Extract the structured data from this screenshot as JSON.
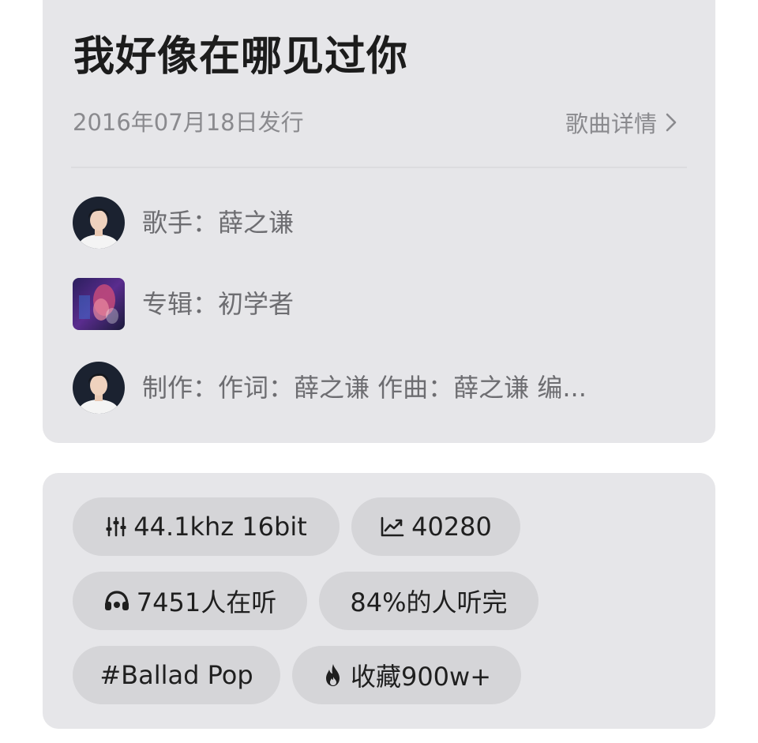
{
  "song": {
    "title": "我好像在哪见过你",
    "release_date": "2016年07月18日发行",
    "detail_link": "歌曲详情"
  },
  "info": {
    "singer": "歌手：薛之谦",
    "album": "专辑：初学者",
    "production": "制作：作词：薛之谦  作曲：薛之谦  编..."
  },
  "tags": {
    "quality": "44.1khz  16bit",
    "trend": "40280",
    "listeners": "7451人在听",
    "completion": "84%的人听完",
    "genre": "#Ballad Pop",
    "favorites": "收藏900w+"
  },
  "icons": {
    "detail_chevron": "chevron-right-icon",
    "quality": "equalizer-icon",
    "trend": "trend-up-icon",
    "listeners": "headphones-icon",
    "favorites": "flame-icon"
  },
  "colors": {
    "card_bg": "#e6e6e9",
    "tag_bg": "#d5d5d8",
    "title": "#1c1c1c",
    "muted_text": "#8a8a8e"
  }
}
